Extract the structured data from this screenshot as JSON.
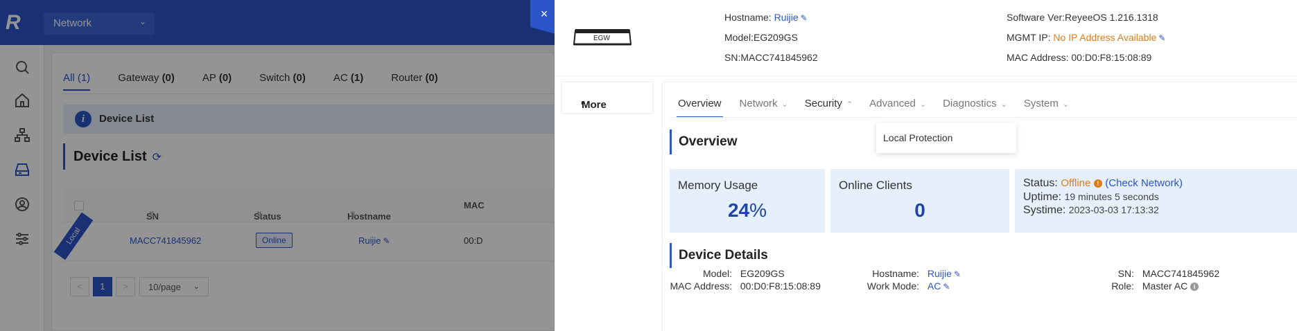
{
  "app": {
    "logo_text": "R",
    "network_select": "Network"
  },
  "nav": {
    "icons": [
      "search-icon",
      "home-icon",
      "topology-icon",
      "devices-icon",
      "user-icon",
      "settings-sliders-icon"
    ]
  },
  "list_page": {
    "tabs": [
      {
        "label": "All",
        "count": "(1)"
      },
      {
        "label": "Gateway",
        "count": "(0)"
      },
      {
        "label": "AP",
        "count": "(0)"
      },
      {
        "label": "Switch",
        "count": "(0)"
      },
      {
        "label": "AC",
        "count": "(1)"
      },
      {
        "label": "Router",
        "count": "(0)"
      }
    ],
    "info_bar": "Device List",
    "section_title": "Device List",
    "columns": [
      "SN",
      "Status",
      "Hostname",
      "MAC"
    ],
    "row": {
      "badge": "Local",
      "sn": "MACC741845962",
      "status": "Online",
      "hostname": "Ruijie",
      "mac": "00:D"
    },
    "pager": {
      "prev": "<",
      "current": "1",
      "next": ">",
      "page_size": "10/page"
    }
  },
  "drawer": {
    "close": "×",
    "device_label": "EGW",
    "hostname_label": "Hostname:",
    "hostname_value": "Ruijie",
    "model": "Model:EG209GS",
    "sn": "SN:MACC741845962",
    "software": "Software Ver:ReyeeOS 1.216.1318",
    "mgmt_label": "MGMT IP:",
    "mgmt_value": "No IP Address Available",
    "mac": "MAC Address: 00:D0:F8:15:08:89",
    "more": "More",
    "tabs": [
      "Overview",
      "Network",
      "Security",
      "Advanced",
      "Diagnostics",
      "System"
    ],
    "security_menu": [
      "Local Protection"
    ],
    "overview_title": "Overview",
    "memory": {
      "label": "Memory Usage",
      "value": "24",
      "unit": "%"
    },
    "clients": {
      "label": "Online Clients",
      "value": "0"
    },
    "status": {
      "status_label": "Status:",
      "status_value": "Offline",
      "check_link": "(Check Network)",
      "uptime_label": "Uptime:",
      "uptime_value": "19 minutes 5 seconds",
      "systime_label": "Systime:",
      "systime_value": "2023-03-03 17:13:32"
    },
    "details_title": "Device Details",
    "details": {
      "model_label": "Model:",
      "model_value": "EG209GS",
      "hostname_label": "Hostname:",
      "hostname_value": "Ruijie",
      "sn_label": "SN:",
      "sn_value": "MACC741845962",
      "mac_label": "MAC Address:",
      "mac_value": "00:D0:F8:15:08:89",
      "workmode_label": "Work Mode:",
      "workmode_value": "AC",
      "role_label": "Role:",
      "role_value": "Master AC"
    }
  },
  "colors": {
    "accent": "#2b55c9",
    "warning": "#e07b15",
    "card_bg": "#e6f0fc"
  }
}
